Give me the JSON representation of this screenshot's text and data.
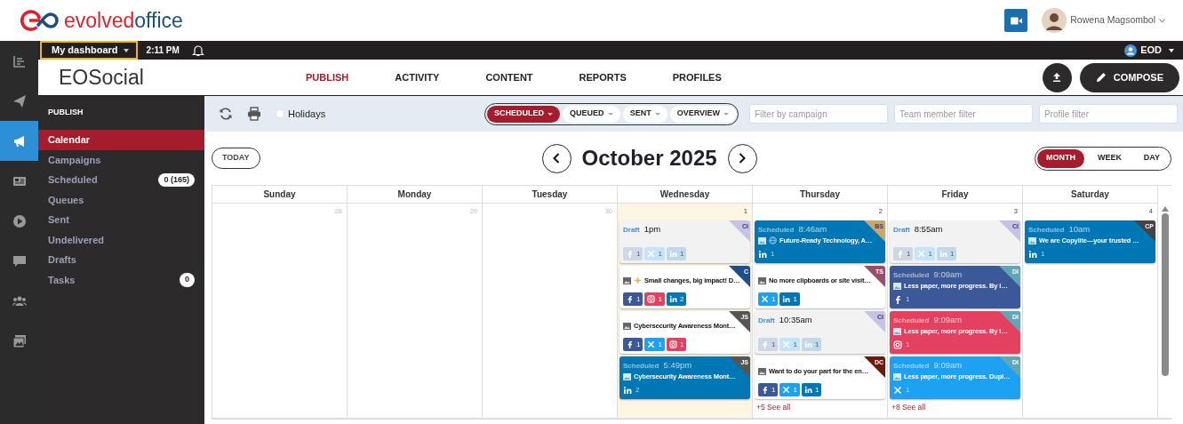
{
  "header": {
    "logo": {
      "part_1": "evolved",
      "part_2": "office"
    },
    "user_name": "Rowena Magsombol"
  },
  "topbar": {
    "dashboard": "My dashboard",
    "time": "2:11 PM",
    "account": "EOD"
  },
  "rail": [
    {
      "kind": "analytics",
      "selected": false
    },
    {
      "kind": "send",
      "selected": false
    },
    {
      "kind": "megaphone",
      "selected": true
    },
    {
      "kind": "news",
      "selected": false
    },
    {
      "kind": "play",
      "selected": false
    },
    {
      "kind": "chat",
      "selected": false
    },
    {
      "kind": "team",
      "selected": false
    },
    {
      "kind": "gallery",
      "selected": false
    }
  ],
  "app_title": "EOSocial",
  "tabs": [
    {
      "label": "PUBLISH",
      "selected": true
    },
    {
      "label": "ACTIVITY",
      "selected": false
    },
    {
      "label": "CONTENT",
      "selected": false
    },
    {
      "label": "REPORTS",
      "selected": false
    },
    {
      "label": "PROFILES",
      "selected": false
    }
  ],
  "compose": "COMPOSE",
  "sidebar": {
    "heading": "PUBLISH",
    "items": [
      {
        "label": "Calendar",
        "selected": true
      },
      {
        "label": "Campaigns",
        "selected": false
      },
      {
        "label": "Scheduled",
        "selected": false,
        "badge": "0 (165)"
      },
      {
        "label": "Queues",
        "selected": false
      },
      {
        "label": "Sent",
        "selected": false
      },
      {
        "label": "Undelivered",
        "selected": false
      },
      {
        "label": "Drafts",
        "selected": false
      },
      {
        "label": "Tasks",
        "selected": false,
        "badge": "0"
      }
    ]
  },
  "toolbar": {
    "holidays": {
      "label": "Holidays",
      "checked": false
    },
    "status_filters": [
      {
        "label": "SCHEDULED",
        "selected": true
      },
      {
        "label": "QUEUED",
        "selected": false
      },
      {
        "label": "SENT",
        "selected": false
      },
      {
        "label": "OVERVIEW",
        "selected": false
      }
    ],
    "filters": [
      {
        "placeholder": "Filter by campaign"
      },
      {
        "placeholder": "Team member filter"
      },
      {
        "placeholder": "Profile filter"
      }
    ]
  },
  "calendar": {
    "today_button": "TODAY",
    "title": "October 2025",
    "views": [
      {
        "label": "MONTH",
        "selected": true
      },
      {
        "label": "WEEK",
        "selected": false
      },
      {
        "label": "DAY",
        "selected": false
      }
    ],
    "weekdays": [
      "Sunday",
      "Monday",
      "Tuesday",
      "Wednesday",
      "Thursday",
      "Friday",
      "Saturday"
    ],
    "days": [
      {
        "number": "28",
        "other_month": true,
        "today": false
      },
      {
        "number": "29",
        "other_month": true,
        "today": false
      },
      {
        "number": "30",
        "other_month": true,
        "today": false
      },
      {
        "number": "1",
        "other_month": false,
        "today": true,
        "posts": [
          {
            "kind": "draft",
            "status": "Draft",
            "time": "1pm",
            "tag": {
              "initials": "CI",
              "color": "#c5c3e8"
            },
            "networks": [
              {
                "kind": "facebook",
                "count": "1"
              },
              {
                "kind": "x",
                "count": "1"
              },
              {
                "kind": "linkedin",
                "count": "1"
              }
            ]
          },
          {
            "kind": "post",
            "lead_icon": {
              "kind": "sparkle"
            },
            "text": "Small changes, big impact! D…",
            "tag": {
              "initials": "C",
              "color": "#1f4e8c"
            },
            "networks": [
              {
                "kind": "facebook",
                "count": "1"
              },
              {
                "kind": "instagram",
                "count": "1"
              },
              {
                "kind": "linkedin",
                "count": "2"
              }
            ]
          },
          {
            "kind": "post",
            "text": "Cybersecurity Awareness Mont…",
            "tag": {
              "initials": "JS",
              "color": "#555555"
            },
            "networks": [
              {
                "kind": "facebook",
                "count": "1"
              },
              {
                "kind": "x",
                "count": "1"
              },
              {
                "kind": "instagram",
                "count": "1"
              }
            ]
          },
          {
            "kind": "scheduled",
            "status": "Scheduled",
            "time": "5:49pm",
            "text": "Cybersecurity Awareness Mont…",
            "tag": {
              "initials": "JS",
              "color": "#555555"
            },
            "color": "#0077b5",
            "networks": [
              {
                "kind": "linkedin",
                "count": "2"
              }
            ]
          }
        ]
      },
      {
        "number": "2",
        "other_month": false,
        "today": false,
        "see_all": "+5 See all",
        "posts": [
          {
            "kind": "scheduled",
            "status": "Scheduled",
            "time": "8:46am",
            "lead_icon": {
              "kind": "globe"
            },
            "text": "Future-Ready Technology, A…",
            "tag": {
              "initials": "BS",
              "color": "#c9a76a"
            },
            "color": "#0077b5",
            "networks": [
              {
                "kind": "linkedin",
                "count": "1"
              }
            ]
          },
          {
            "kind": "post",
            "text": "No more clipboards or site visit…",
            "tag": {
              "initials": "TS",
              "color": "#9c4a6e"
            },
            "networks": [
              {
                "kind": "x",
                "count": "1"
              },
              {
                "kind": "linkedin",
                "count": "1"
              }
            ]
          },
          {
            "kind": "draft",
            "status": "Draft",
            "time": "10:35am",
            "tag": {
              "initials": "CI",
              "color": "#c5c3e8"
            },
            "networks": [
              {
                "kind": "facebook",
                "count": "1"
              },
              {
                "kind": "x",
                "count": "1"
              },
              {
                "kind": "linkedin",
                "count": "1"
              }
            ]
          },
          {
            "kind": "post",
            "text": "Want to do your part for the en…",
            "tag": {
              "initials": "DC",
              "color": "#6b1a0a"
            },
            "networks": [
              {
                "kind": "facebook",
                "count": "1"
              },
              {
                "kind": "x",
                "count": "1"
              },
              {
                "kind": "linkedin",
                "count": "1"
              }
            ]
          }
        ]
      },
      {
        "number": "3",
        "other_month": false,
        "today": false,
        "see_all": "+8 See all",
        "posts": [
          {
            "kind": "draft",
            "status": "Draft",
            "time": "8:55am",
            "tag": {
              "initials": "CI",
              "color": "#c5c3e8"
            },
            "networks": [
              {
                "kind": "facebook",
                "count": "1"
              },
              {
                "kind": "x",
                "count": "1"
              },
              {
                "kind": "linkedin",
                "count": "1"
              }
            ]
          },
          {
            "kind": "scheduled",
            "status": "Scheduled",
            "time": "9:09am",
            "text": "Less paper, more progress. By i…",
            "tag": {
              "initials": "DI",
              "color": "#5fa7b5"
            },
            "color": "#3b5998",
            "networks": [
              {
                "kind": "facebook",
                "count": "1"
              }
            ]
          },
          {
            "kind": "scheduled",
            "status": "Scheduled",
            "time": "9:09am",
            "text": "Less paper, more progress. By i…",
            "tag": {
              "initials": "DI",
              "color": "#5fa7b5"
            },
            "color": "#e4405f",
            "networks": [
              {
                "kind": "instagram",
                "count": "1"
              }
            ]
          },
          {
            "kind": "scheduled",
            "status": "Scheduled",
            "time": "9:09am",
            "text": "Less paper, more progress. Dupl…",
            "tag": {
              "initials": "DI",
              "color": "#5fa7b5"
            },
            "color": "#1da1f2",
            "networks": [
              {
                "kind": "x",
                "count": "1"
              }
            ]
          }
        ]
      },
      {
        "number": "4",
        "other_month": false,
        "today": false,
        "posts": [
          {
            "kind": "scheduled",
            "status": "Scheduled",
            "time": "10am",
            "text": "We are Copylite—your trusted …",
            "tag": {
              "initials": "CP",
              "color": "#444444"
            },
            "color": "#0077b5",
            "networks": [
              {
                "kind": "linkedin",
                "count": "1"
              }
            ]
          }
        ]
      }
    ]
  }
}
